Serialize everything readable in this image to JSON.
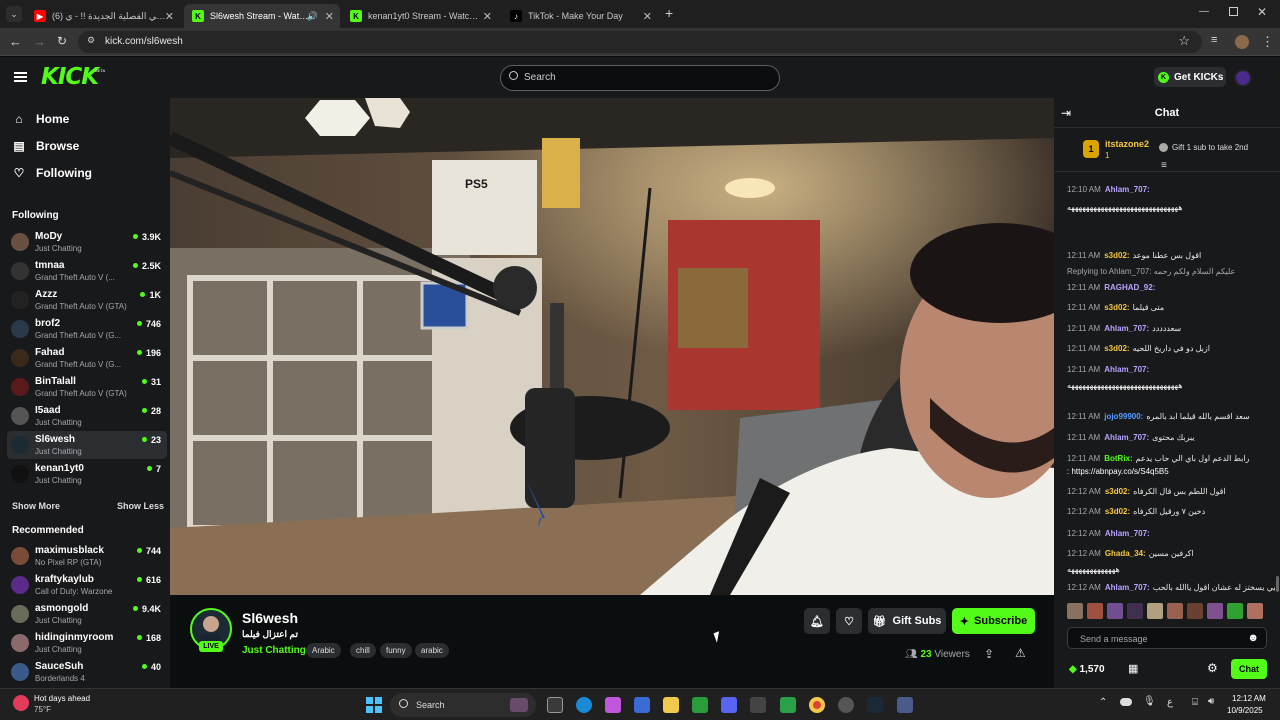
{
  "browser": {
    "tabs": [
      {
        "label": "(6) ملاهي الفصلية الجديدة !! - ي",
        "active": false
      },
      {
        "label": "Sl6wesh Stream - Watch Live",
        "active": true
      },
      {
        "label": "kenan1yt0 Stream - Watch Live",
        "active": false
      },
      {
        "label": "TikTok - Make Your Day",
        "active": false
      }
    ],
    "url": "kick.com/sl6wesh"
  },
  "header": {
    "logo": "KICK",
    "beta": "BETA",
    "search_placeholder": "Search",
    "get_kicks": "Get KICKs"
  },
  "sidebar": {
    "nav": [
      {
        "label": "Home",
        "icon": "home-icon"
      },
      {
        "label": "Browse",
        "icon": "browse-icon"
      },
      {
        "label": "Following",
        "icon": "heart-icon"
      }
    ],
    "following_title": "Following",
    "following": [
      {
        "name": "MoDy",
        "category": "Just Chatting",
        "viewers": "3.9K"
      },
      {
        "name": "tmnaa",
        "category": "Grand Theft Auto V (...",
        "viewers": "2.5K"
      },
      {
        "name": "Azzz",
        "category": "Grand Theft Auto V (GTA)",
        "viewers": "1K"
      },
      {
        "name": "brof2",
        "category": "Grand Theft Auto V (G...",
        "viewers": "746"
      },
      {
        "name": "Fahad",
        "category": "Grand Theft Auto V (G...",
        "viewers": "196"
      },
      {
        "name": "BinTalall",
        "category": "Grand Theft Auto V (GTA)",
        "viewers": "31"
      },
      {
        "name": "I5aad",
        "category": "Just Chatting",
        "viewers": "28"
      },
      {
        "name": "Sl6wesh",
        "category": "Just Chatting",
        "viewers": "23"
      },
      {
        "name": "kenan1yt0",
        "category": "Just Chatting",
        "viewers": "7"
      }
    ],
    "show_more": "Show More",
    "show_less": "Show Less",
    "recommended_title": "Recommended",
    "recommended": [
      {
        "name": "maximusblack",
        "category": "No Pixel RP (GTA)",
        "viewers": "744"
      },
      {
        "name": "kraftykaylub",
        "category": "Call of Duty: Warzone",
        "viewers": "616"
      },
      {
        "name": "asmongold",
        "category": "Just Chatting",
        "viewers": "9.4K"
      },
      {
        "name": "hidinginmyroom",
        "category": "Just Chatting",
        "viewers": "168"
      },
      {
        "name": "SauceSuh",
        "category": "Borderlands 4",
        "viewers": "40"
      }
    ]
  },
  "stream": {
    "live": "LIVE",
    "name": "Sl6wesh",
    "title": "تم اعتزال فيلما",
    "category": "Just Chatting",
    "tags": [
      "Arabic",
      "chill",
      "funny",
      "arabic"
    ],
    "gift_subs": "Gift Subs",
    "subscribe": "Subscribe",
    "viewers_count": "23",
    "viewers_label": "Viewers",
    "video_overlay": "PS5"
  },
  "chat": {
    "title": "Chat",
    "pinned": {
      "rank": "1",
      "user": "itstazone2",
      "count": "1",
      "note": "Gift 1 sub to take 2nd"
    },
    "messages": [
      {
        "time": "12:10 AM",
        "user": "Ahlam_707:",
        "text": "",
        "color": "#b9a3ff"
      },
      {
        "time": "",
        "user": "",
        "text": "ههههههههههههههههههههههههههههههه",
        "color": "#fff"
      },
      {
        "time": "12:11 AM",
        "user": "s3d02:",
        "text": "اقول بس عطنا موعد",
        "color": "#f6c744"
      },
      {
        "time": "",
        "user": "",
        "text": "Replying to Ahlam_707: عليكم السلام ولكم رحمه",
        "color": "#a5a7ab"
      },
      {
        "time": "12:11 AM",
        "user": "RAGHAD_92:",
        "text": "",
        "color": "#b9a3ff"
      },
      {
        "time": "12:11 AM",
        "user": "s3d02:",
        "text": "متى قيلما",
        "color": "#f6c744"
      },
      {
        "time": "12:11 AM",
        "user": "Ahlam_707:",
        "text": "سعددددد",
        "color": "#b9a3ff"
      },
      {
        "time": "12:11 AM",
        "user": "s3d02:",
        "text": "ازبل دو في داريخ اللحيه",
        "color": "#f6c744"
      },
      {
        "time": "12:11 AM",
        "user": "Ahlam_707:",
        "text": "",
        "color": "#b9a3ff"
      },
      {
        "time": "",
        "user": "",
        "text": "ههههههههههههههههههههههههههههههه",
        "color": "#fff"
      },
      {
        "time": "12:11 AM",
        "user": "jojo99900:",
        "text": "سعد اقسم بالله قيلما ابد بالمره",
        "color": "#5a9bff"
      },
      {
        "time": "12:11 AM",
        "user": "Ahlam_707:",
        "text": "يبربك محتوى",
        "color": "#b9a3ff"
      },
      {
        "time": "12:11 AM",
        "user": "BotRix:",
        "text": "رابط الدعم اول باي الي حاب يدعم",
        "color": "#53fc18"
      },
      {
        "time": "",
        "user": "",
        "text": ": https://abnpay.co/s/S4q5B5",
        "color": "#fff"
      },
      {
        "time": "12:12 AM",
        "user": "s3d02:",
        "text": "اقول اللطم بس قال الكرفاه",
        "color": "#f6c744"
      },
      {
        "time": "12:12 AM",
        "user": "s3d02:",
        "text": "دخين ٧ ورقيل الكرفاه",
        "color": "#f6c744"
      },
      {
        "time": "12:12 AM",
        "user": "Ahlam_707:",
        "text": "",
        "color": "#b9a3ff"
      },
      {
        "time": "12:12 AM",
        "user": "Ghada_34:",
        "text": "اكرفين مسين",
        "color": "#f6c744"
      },
      {
        "time": "",
        "user": "",
        "text": "هههههههههههههه",
        "color": "#fff"
      },
      {
        "time": "12:12 AM",
        "user": "Ahlam_707:",
        "text": "هو بيي يسختز له عشان اقول ياالله بالحب",
        "color": "#b9a3ff"
      }
    ],
    "send_placeholder": "Send a message",
    "kicks_count": "1,570",
    "chat_button": "Chat"
  },
  "taskbar": {
    "weather_title": "Hot days ahead",
    "weather_temp": "75°F",
    "search": "Search",
    "time": "12:12 AM",
    "date": "10/9/2025"
  }
}
